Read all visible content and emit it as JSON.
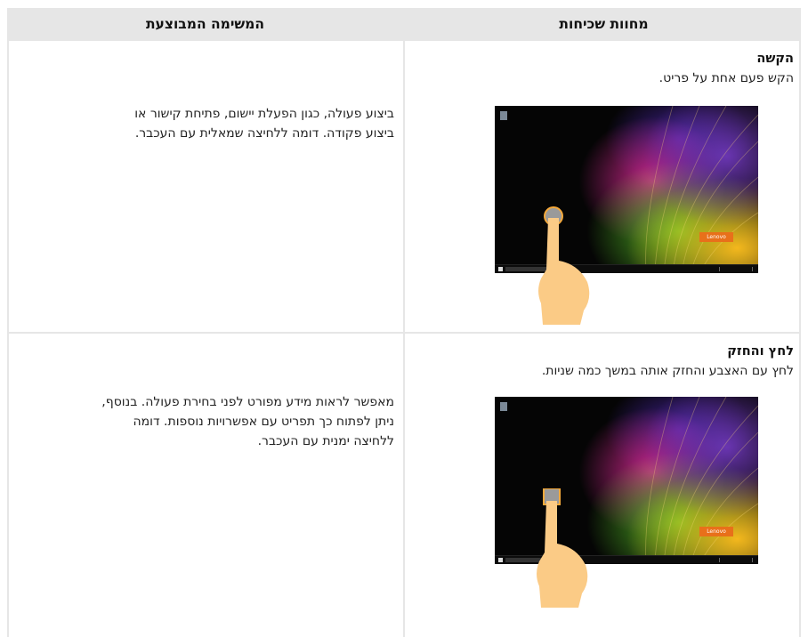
{
  "headers": {
    "gestures": "מחוות שכיחות",
    "task": "המשימה המבוצעת"
  },
  "rows": [
    {
      "title": "הקשה",
      "description": "הקש פעם אחת על פריט.",
      "task_lines": [
        "ביצוע פעולה, כגון הפעלת יישום, פתיחת קישור או",
        "ביצוע פקודה. דומה ללחיצה שמאלית עם העכבר."
      ],
      "screen_brand": "Lenovo"
    },
    {
      "title": "לחץ והחזק",
      "description": "לחץ עם האצבע והחזק אותה במשך כמה שניות.",
      "task_lines": [
        "מאפשר לראות מידע מפורט לפני בחירת פעולה. בנוסף,",
        "ניתן לפתוח כך תפריט עם אפשרויות נוספות. דומה",
        "ללחיצה ימנית עם העכבר."
      ],
      "screen_brand": "Lenovo"
    }
  ],
  "colors": {
    "header_bg": "#e6e6e6",
    "touch_marker": "#f5a93b",
    "hand": "#fbcb86"
  }
}
